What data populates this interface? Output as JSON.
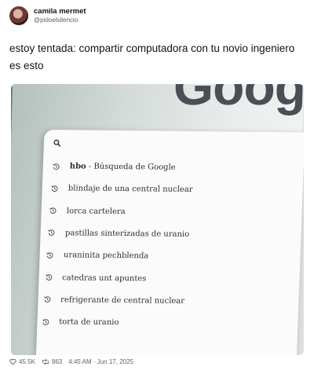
{
  "author": {
    "display_name": "camila mermet",
    "handle": "@pidoelsilencio"
  },
  "tweet": {
    "text": "estoy tentada: compartir computadora con tu novio ingeniero es esto"
  },
  "photo": {
    "logo_fragment": "Google",
    "suggestions": [
      {
        "bold": "hbo",
        "rest": " - Búsqueda de Google"
      },
      {
        "bold": "",
        "rest": "blindaje de una central nuclear"
      },
      {
        "bold": "",
        "rest": "lorca cartelera"
      },
      {
        "bold": "",
        "rest": "pastillas sinterizadas de uranio"
      },
      {
        "bold": "",
        "rest": "uraninita pechblenda"
      },
      {
        "bold": "",
        "rest": "catedras unt apuntes"
      },
      {
        "bold": "",
        "rest": "refrigerante de central nuclear"
      },
      {
        "bold": "",
        "rest": "torta de uranio"
      }
    ]
  },
  "stats": {
    "likes": "45.5K",
    "retweets": "863",
    "timestamp": "4:45 AM · Jun 17, 2025"
  },
  "icons": {
    "search": "search-icon",
    "history": "history-icon",
    "like": "heart-icon",
    "retweet": "retweet-icon"
  }
}
